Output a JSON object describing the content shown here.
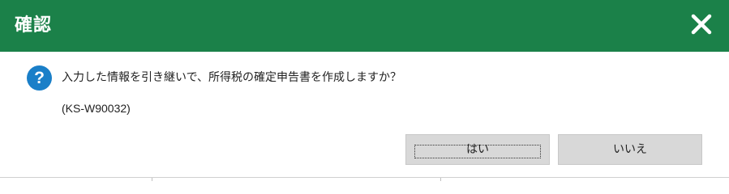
{
  "dialog": {
    "title": "確認",
    "close_icon": "close-icon",
    "message_icon": "question-icon",
    "message_icon_glyph": "?",
    "message": "入力した情報を引き継いで、所得税の確定申告書を作成しますか？",
    "code": "(KS-W90032)",
    "buttons": {
      "yes_label": "はい",
      "no_label": "いいえ"
    }
  },
  "colors": {
    "titlebar": "#1b8149",
    "question_icon": "#1a7fc8",
    "button_bg": "#d8d8d8"
  }
}
